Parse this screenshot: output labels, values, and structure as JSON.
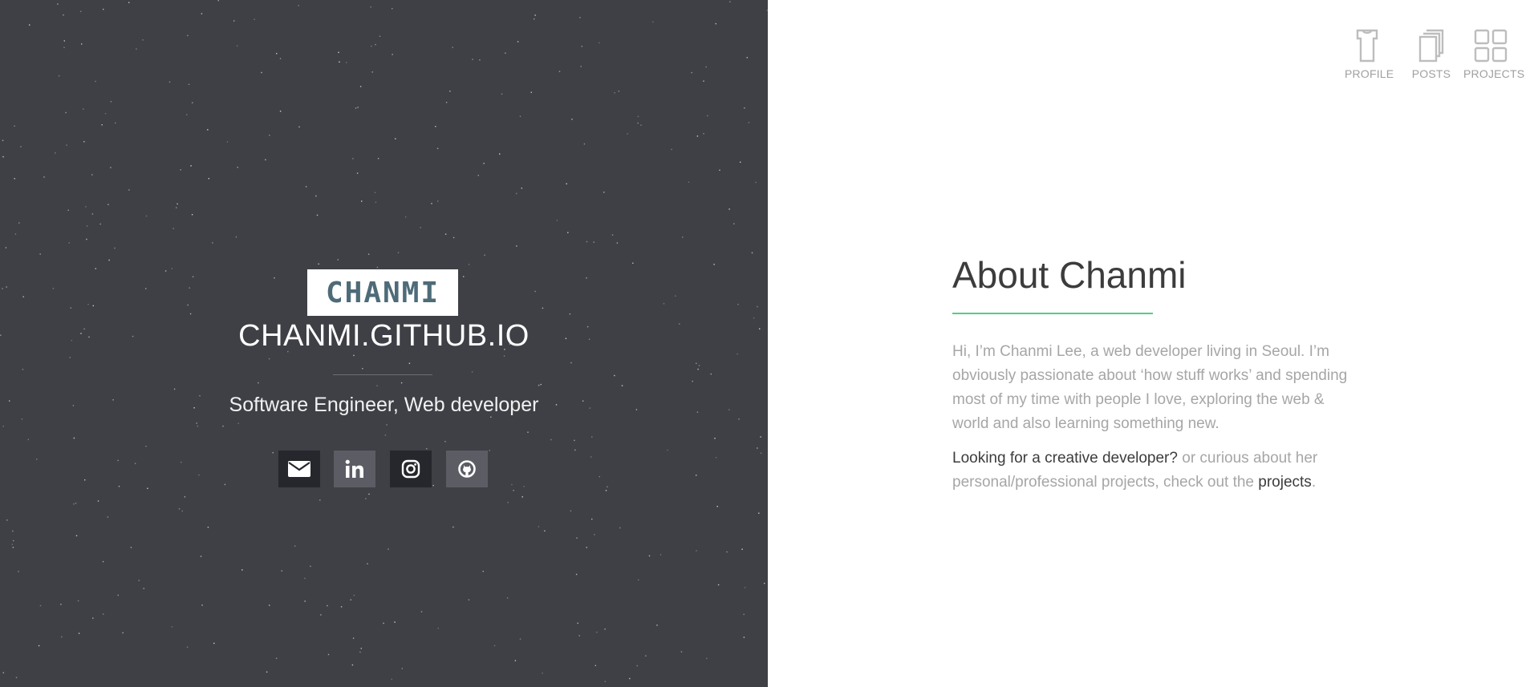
{
  "hero": {
    "logo_text": "CHANMI",
    "site_title": "CHANMI.GITHUB.IO",
    "subtitle": "Software Engineer, Web developer",
    "social": [
      "email",
      "linkedin",
      "instagram",
      "github"
    ]
  },
  "nav": {
    "items": [
      {
        "label": "PROFILE",
        "icon": "shirt-icon"
      },
      {
        "label": "POSTS",
        "icon": "documents-icon"
      },
      {
        "label": "PROJECTS",
        "icon": "grid-icon"
      }
    ]
  },
  "about": {
    "title": "About Chanmi",
    "paragraph1": "Hi, I’m Chanmi Lee, a web developer living in Seoul. I’m obviously passionate about ‘how stuff works’ and spending most of my time with people I love, exploring the web & world and also learning something new.",
    "p2_link1": "Looking for a creative developer?",
    "p2_mid": " or curious about her personal/professional projects, check out the ",
    "p2_link2": "projects",
    "p2_end": "."
  },
  "colors": {
    "left_bg": "#3f4046",
    "accent": "#4fd083",
    "logo_text": "#4e6b78"
  }
}
